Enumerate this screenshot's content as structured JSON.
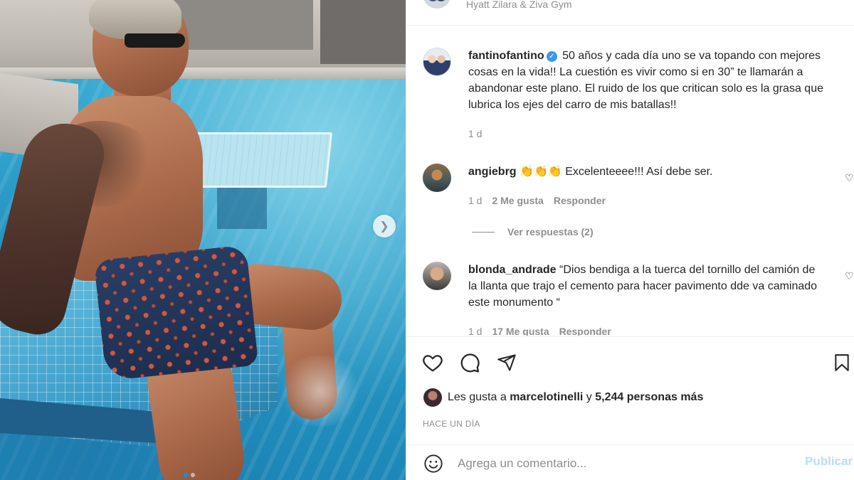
{
  "post": {
    "location": "Hyatt Zilara & Ziva Gym",
    "caption": {
      "username": "fantinofantino",
      "text": "50 años y cada día uno se va topando con mejores cosas en la vida!! La cuestión es vivir como si en 30” te llamarán a abandonar este plano. El ruido de los que critican solo es la grasa que lubrica los ejes del carro de mis batallas!!",
      "time": "1 d"
    },
    "comments": [
      {
        "username": "angiebrg",
        "text": "👏👏👏 Excelenteeee!!! Así debe ser.",
        "time": "1 d",
        "likes": "2 Me gusta",
        "reply": "Responder",
        "view_replies": "Ver respuestas (2)"
      },
      {
        "username": "blonda_andrade",
        "text": "“Dios bendiga a la tuerca del tornillo del camión de la llanta que trajo el cemento para hacer pavimento dde va caminado este monumento “",
        "time": "1 d",
        "likes": "17 Me gusta",
        "reply": "Responder"
      }
    ],
    "likes_summary": {
      "prefix": "Les gusta a",
      "user": "marcelotinelli",
      "connector": "y",
      "count": "5,244 personas más"
    },
    "timestamp": "HACE UN DÍA",
    "add_comment": {
      "placeholder": "Agrega un comentario...",
      "publish": "Publicar"
    },
    "carousel": {
      "current": 1,
      "total": 2
    },
    "colors": {
      "accent": "#0095f6",
      "publish_disabled": "#b2dffc",
      "muted": "#8e8e8e",
      "verified": "#3897f0"
    }
  }
}
